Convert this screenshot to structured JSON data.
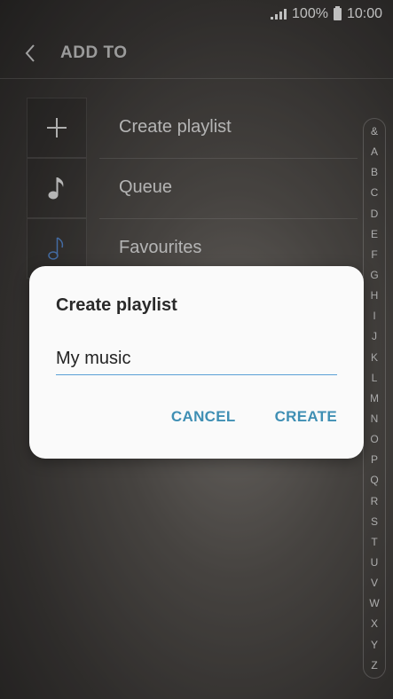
{
  "status_bar": {
    "battery": "100%",
    "time": "10:00"
  },
  "header": {
    "title": "ADD TO"
  },
  "list": {
    "items": [
      {
        "label": "Create playlist",
        "icon": "plus-icon"
      },
      {
        "label": "Queue",
        "icon": "music-note-icon"
      },
      {
        "label": "Favourites",
        "icon": "music-note-icon"
      }
    ]
  },
  "index": {
    "letters": [
      "&",
      "A",
      "B",
      "C",
      "D",
      "E",
      "F",
      "G",
      "H",
      "I",
      "J",
      "K",
      "L",
      "M",
      "N",
      "O",
      "P",
      "Q",
      "R",
      "S",
      "T",
      "U",
      "V",
      "W",
      "X",
      "Y",
      "Z"
    ]
  },
  "dialog": {
    "title": "Create playlist",
    "input_value": "My music",
    "cancel_label": "CANCEL",
    "create_label": "CREATE"
  },
  "colors": {
    "accent": "#3f8fb4",
    "input_underline": "#5aa0d6",
    "favourites_icon": "#5a8fd8"
  }
}
